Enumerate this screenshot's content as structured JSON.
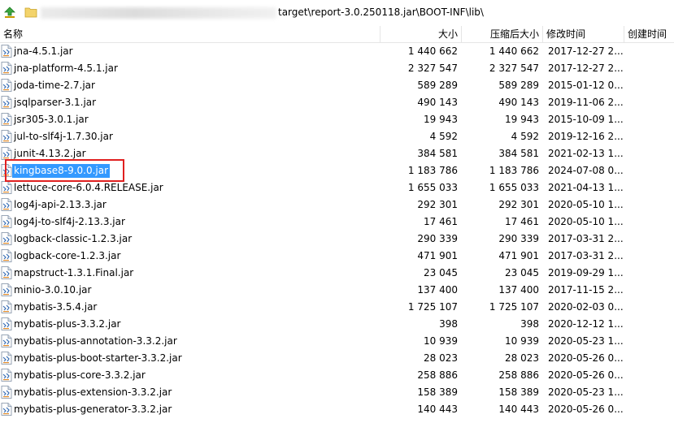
{
  "path": {
    "visible_text": "target\\report-3.0.250118.jar\\BOOT-INF\\lib\\"
  },
  "columns": {
    "name": "名称",
    "size": "大小",
    "compressed": "压缩后大小",
    "modified": "修改时间",
    "created": "创建时间"
  },
  "files": [
    {
      "name": "jna-4.5.1.jar",
      "size": "1 440 662",
      "compressed": "1 440 662",
      "modified": "2017-12-27 2..."
    },
    {
      "name": "jna-platform-4.5.1.jar",
      "size": "2 327 547",
      "compressed": "2 327 547",
      "modified": "2017-12-27 2..."
    },
    {
      "name": "joda-time-2.7.jar",
      "size": "589 289",
      "compressed": "589 289",
      "modified": "2015-01-12 0..."
    },
    {
      "name": "jsqlparser-3.1.jar",
      "size": "490 143",
      "compressed": "490 143",
      "modified": "2019-11-06 2..."
    },
    {
      "name": "jsr305-3.0.1.jar",
      "size": "19 943",
      "compressed": "19 943",
      "modified": "2015-10-09 1..."
    },
    {
      "name": "jul-to-slf4j-1.7.30.jar",
      "size": "4 592",
      "compressed": "4 592",
      "modified": "2019-12-16 2..."
    },
    {
      "name": "junit-4.13.2.jar",
      "size": "384 581",
      "compressed": "384 581",
      "modified": "2021-02-13 1..."
    },
    {
      "name": "kingbase8-9.0.0.jar",
      "size": "1 183 786",
      "compressed": "1 183 786",
      "modified": "2024-07-08 0...",
      "selected": true
    },
    {
      "name": "lettuce-core-6.0.4.RELEASE.jar",
      "size": "1 655 033",
      "compressed": "1 655 033",
      "modified": "2021-04-13 1..."
    },
    {
      "name": "log4j-api-2.13.3.jar",
      "size": "292 301",
      "compressed": "292 301",
      "modified": "2020-05-10 1..."
    },
    {
      "name": "log4j-to-slf4j-2.13.3.jar",
      "size": "17 461",
      "compressed": "17 461",
      "modified": "2020-05-10 1..."
    },
    {
      "name": "logback-classic-1.2.3.jar",
      "size": "290 339",
      "compressed": "290 339",
      "modified": "2017-03-31 2..."
    },
    {
      "name": "logback-core-1.2.3.jar",
      "size": "471 901",
      "compressed": "471 901",
      "modified": "2017-03-31 2..."
    },
    {
      "name": "mapstruct-1.3.1.Final.jar",
      "size": "23 045",
      "compressed": "23 045",
      "modified": "2019-09-29 1..."
    },
    {
      "name": "minio-3.0.10.jar",
      "size": "137 400",
      "compressed": "137 400",
      "modified": "2017-11-15 2..."
    },
    {
      "name": "mybatis-3.5.4.jar",
      "size": "1 725 107",
      "compressed": "1 725 107",
      "modified": "2020-02-03 0..."
    },
    {
      "name": "mybatis-plus-3.3.2.jar",
      "size": "398",
      "compressed": "398",
      "modified": "2020-12-12 1..."
    },
    {
      "name": "mybatis-plus-annotation-3.3.2.jar",
      "size": "10 939",
      "compressed": "10 939",
      "modified": "2020-05-23 1..."
    },
    {
      "name": "mybatis-plus-boot-starter-3.3.2.jar",
      "size": "28 023",
      "compressed": "28 023",
      "modified": "2020-05-26 0..."
    },
    {
      "name": "mybatis-plus-core-3.3.2.jar",
      "size": "258 886",
      "compressed": "258 886",
      "modified": "2020-05-26 0..."
    },
    {
      "name": "mybatis-plus-extension-3.3.2.jar",
      "size": "158 389",
      "compressed": "158 389",
      "modified": "2020-05-23 1..."
    },
    {
      "name": "mybatis-plus-generator-3.3.2.jar",
      "size": "140 443",
      "compressed": "140 443",
      "modified": "2020-05-26 0..."
    }
  ],
  "colors": {
    "selection": "#3399ff",
    "highlight_box": "#e02020"
  },
  "icons": {
    "up": "up-arrow-icon",
    "folder": "folder-icon",
    "file": "jar-file-icon"
  }
}
